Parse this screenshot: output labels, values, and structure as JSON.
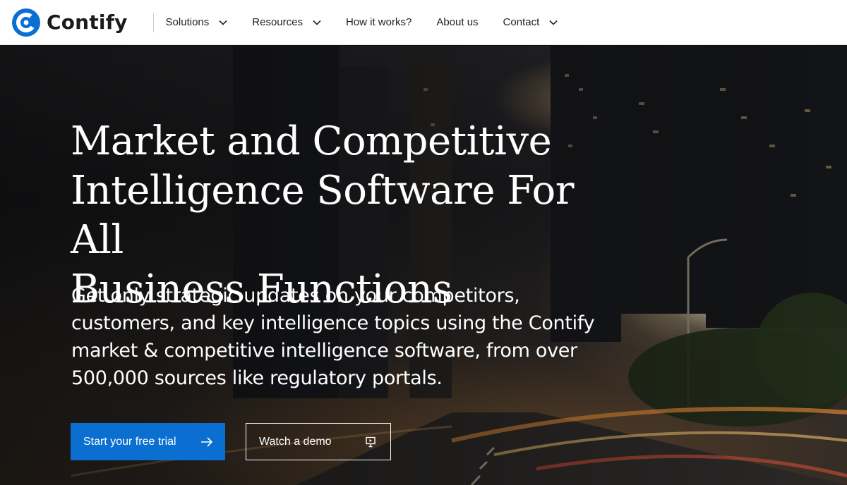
{
  "brand": {
    "name": "Contify",
    "color": "#0a6fd0"
  },
  "nav": {
    "items": [
      {
        "label": "Solutions",
        "has_dropdown": true
      },
      {
        "label": "Resources",
        "has_dropdown": true
      },
      {
        "label": "How it works?",
        "has_dropdown": false
      },
      {
        "label": "About us",
        "has_dropdown": false
      },
      {
        "label": "Contact",
        "has_dropdown": true
      }
    ],
    "dropdown_icon": "chevron-down-icon"
  },
  "hero": {
    "title_lines": [
      "Market and Competitive",
      "Intelligence Software For All",
      "Business Functions"
    ],
    "subtitle_lines": [
      "Get only strategic updates on your competitors,",
      "customers, and key intelligence topics using the Contify",
      "market & competitive intelligence software, from over",
      "500,000 sources like regulatory portals."
    ],
    "primary_cta": {
      "label": "Start your free trial",
      "icon": "arrow-right-icon",
      "color": "#0a6fd0"
    },
    "secondary_cta": {
      "label": "Watch a demo",
      "icon": "presentation-screen-icon"
    }
  }
}
